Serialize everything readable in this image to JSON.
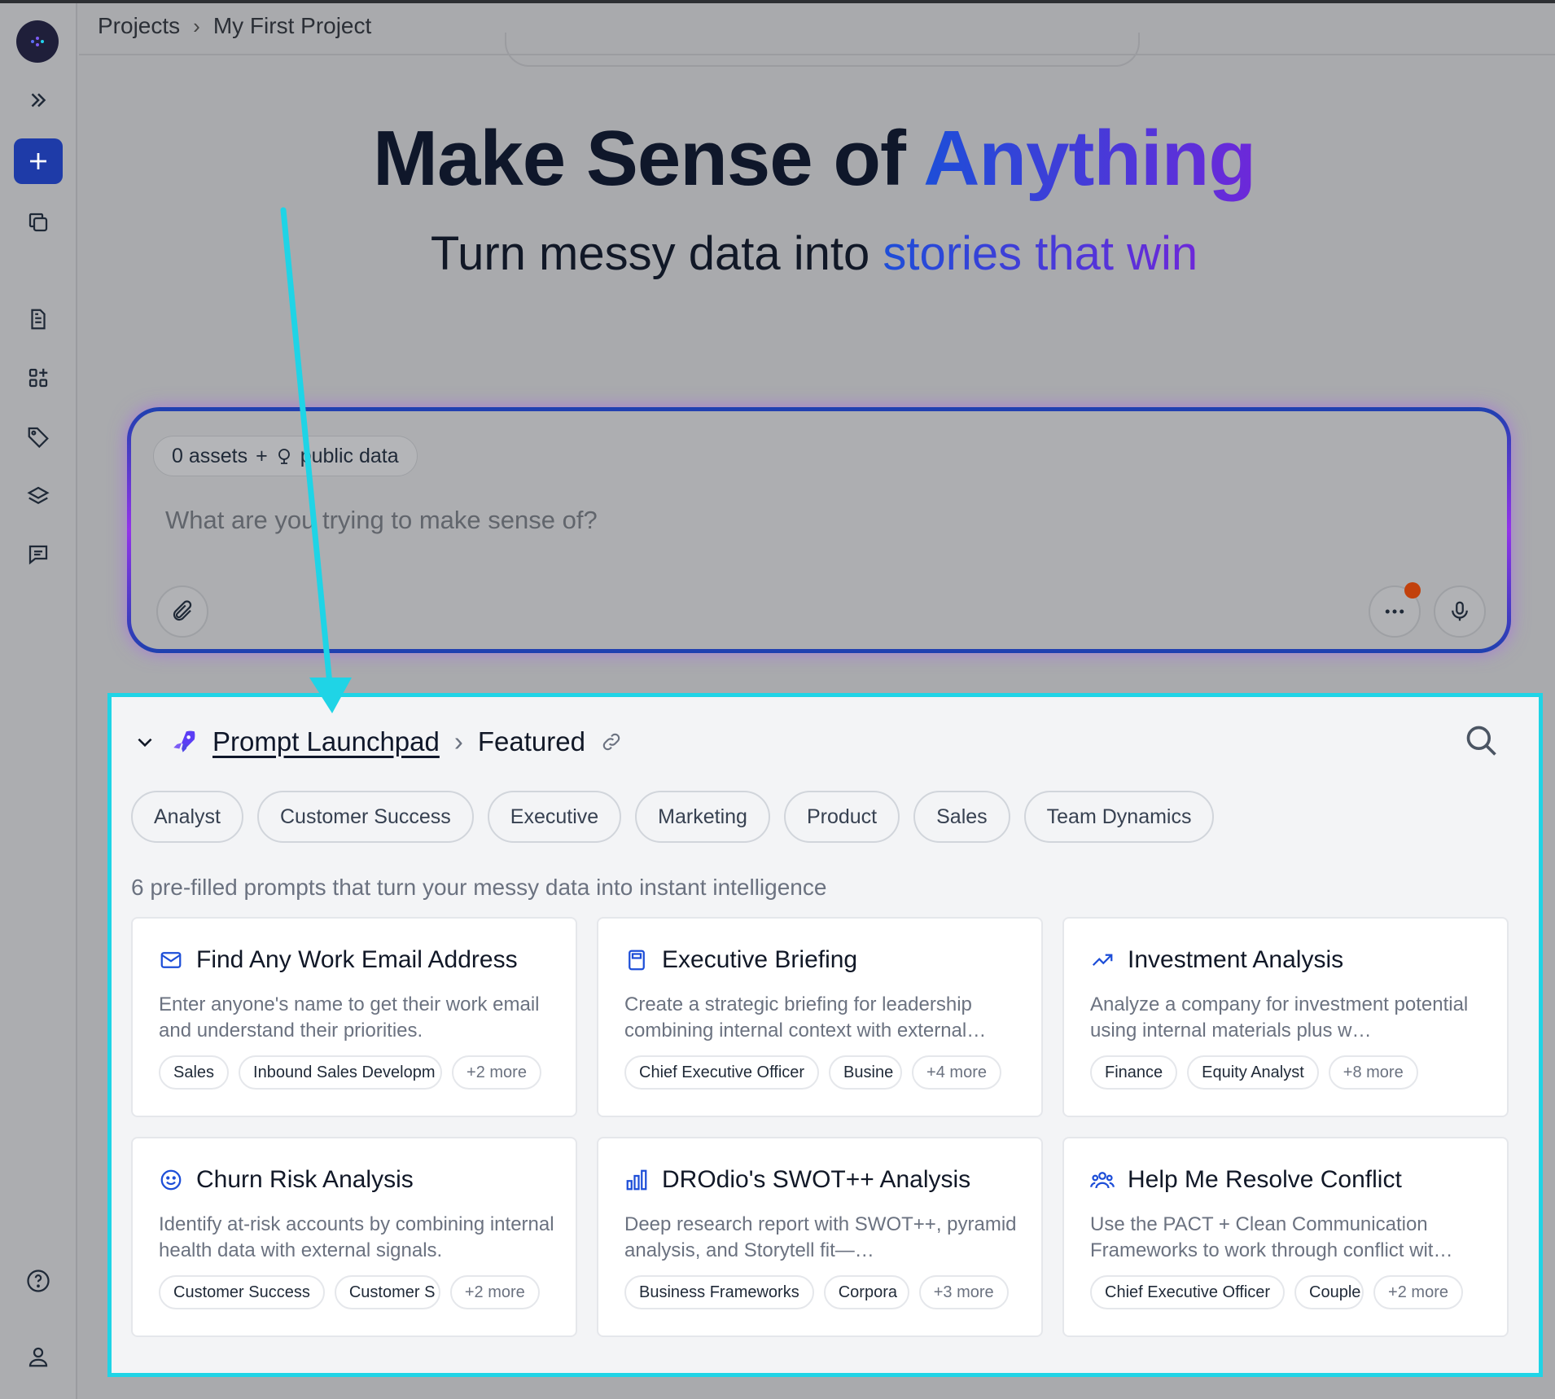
{
  "breadcrumb": {
    "root": "Projects",
    "current": "My First Project"
  },
  "hero": {
    "title_plain": "Make Sense of ",
    "title_accent": "Anything",
    "subtitle_plain": "Turn messy data into ",
    "subtitle_accent": "stories that win"
  },
  "prompt": {
    "assets_label": "0 assets",
    "assets_plus": "+",
    "public_data_label": "public data",
    "placeholder": "What are you trying to make sense of?"
  },
  "launchpad": {
    "title": "Prompt Launchpad",
    "section": "Featured",
    "categories": [
      "Analyst",
      "Customer Success",
      "Executive",
      "Marketing",
      "Product",
      "Sales",
      "Team Dynamics"
    ],
    "description": "6 pre-filled prompts that turn your messy data into instant intelligence",
    "cards": [
      {
        "icon": "mail-icon",
        "title": "Find Any Work Email Address",
        "desc": "Enter anyone's name to get their work email and understand their priorities.",
        "tags": [
          "Sales",
          "Inbound Sales Developm"
        ],
        "more": "+2 more"
      },
      {
        "icon": "calculator-icon",
        "title": "Executive Briefing",
        "desc": "Create a strategic briefing for leadership combining internal context with external…",
        "tags": [
          "Chief Executive Officer",
          "Busine"
        ],
        "more": "+4 more"
      },
      {
        "icon": "trend-up-icon",
        "title": "Investment Analysis",
        "desc": "Analyze a company for investment potential using internal materials plus w…",
        "tags": [
          "Finance",
          "Equity Analyst"
        ],
        "more": "+8 more"
      },
      {
        "icon": "smiley-icon",
        "title": "Churn Risk Analysis",
        "desc": "Identify at-risk accounts by combining internal health data with external signals.",
        "tags": [
          "Customer Success",
          "Customer S"
        ],
        "more": "+2 more"
      },
      {
        "icon": "bar-chart-icon",
        "title": "DROdio's SWOT++ Analysis",
        "desc": "Deep research report with SWOT++, pyramid analysis, and Storytell fit—…",
        "tags": [
          "Business Frameworks",
          "Corpora"
        ],
        "more": "+3 more"
      },
      {
        "icon": "users-icon",
        "title": "Help Me Resolve Conflict",
        "desc": "Use the PACT + Clean Communication Frameworks to work through conflict wit…",
        "tags": [
          "Chief Executive Officer",
          "Couple"
        ],
        "more": "+2 more"
      }
    ]
  },
  "colors": {
    "accent": "#1e3ba8",
    "highlight_border": "#1fd4e6",
    "arrow": "#1fd4e6",
    "notification": "#c2410c"
  }
}
